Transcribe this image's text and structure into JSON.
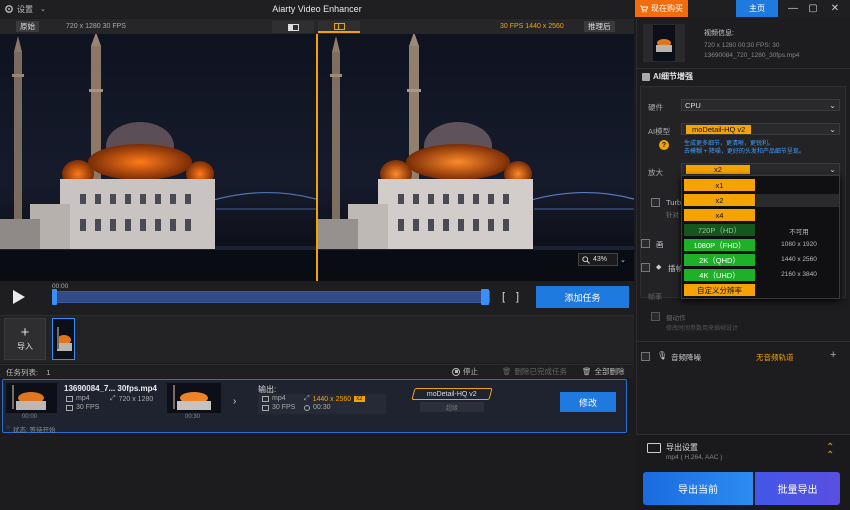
{
  "titlebar": {
    "settings_label": "设置",
    "app_title": "Aiarty Video Enhancer",
    "buy_now": "现在购买",
    "home": "主页"
  },
  "preview": {
    "original_label": "原始",
    "original_info": "720 x 1280  30 FPS",
    "output_info": "30 FPS  1440 x 2560",
    "after_label": "推理后",
    "zoom": "43%"
  },
  "scrub": {
    "time": "00:00",
    "add_task": "添加任务"
  },
  "import": {
    "label": "导入"
  },
  "tasklist": {
    "count_label": "任务列表:",
    "count": "1",
    "stop": "停止",
    "delete_done": "删除已完成任务",
    "delete_all": "全部删除"
  },
  "task": {
    "name": "13690084_7... 30fps.mp4",
    "in_format": "mp4",
    "in_res": "720 x 1280",
    "in_fps": "30 FPS",
    "in_duration": "00:30",
    "thumb_time_left": "00:00",
    "output_label": "输出:",
    "out_format": "mp4",
    "out_res": "1440 x 2560",
    "out_scale": "x2",
    "out_fps": "30 FPS",
    "out_duration": "00:30",
    "model": "moDetail-HQ  v2",
    "model_sub": "超级",
    "modify": "修改",
    "status": "状态: 等待开始"
  },
  "videoinfo": {
    "title": "视频信息:",
    "line1": "720 x 1280    00:30    FPS: 30",
    "line2": "13690084_720_1280_30fps.mp4"
  },
  "ai": {
    "section_title": "AI细节增强",
    "hardware_label": "硬件",
    "hardware_value": "CPU",
    "model_label": "AI模型",
    "model_value": "moDetail-HQ  v2",
    "model_desc_1": "生成更多细节，更清晰，更锐利。",
    "model_desc_2": "去模糊 + 降噪，更好的头发和产品细节呈现。",
    "scale_label": "放大",
    "scale_value": "x2",
    "turbo_label": "Turb",
    "turbo_sub": "针对",
    "dropdown_options": [
      {
        "label": "x1",
        "style": "orange"
      },
      {
        "label": "x2",
        "style": "orange"
      },
      {
        "label": "x4",
        "style": "orange"
      },
      {
        "label": "720P（HD）",
        "style": "darkgreen",
        "res": "不可用"
      },
      {
        "label": "1080P（FHD）",
        "style": "green",
        "res": "1080 x 1920"
      },
      {
        "label": "2K（QHD）",
        "style": "green",
        "res": "1440 x 2560"
      },
      {
        "label": "4K（UHD）",
        "style": "green",
        "res": "2160 x 3840"
      },
      {
        "label": "自定义分辨率",
        "style": "orange"
      }
    ],
    "section2": "画",
    "section3": "插帧",
    "frame_label": "帧率",
    "motion_label": "摄动作",
    "motion_desc": "修改时间参数用来插帧设计",
    "audio_label": "音频降噪",
    "audio_value": "无音频轨道"
  },
  "export": {
    "settings_title": "导出设置",
    "settings_sub": "mp4 ( H.264, AAC )",
    "export_current": "导出当前",
    "export_batch": "批量导出"
  },
  "colors": {
    "accent_blue": "#1f7ae0",
    "accent_orange": "#f5a300",
    "buy_orange": "#f26b0c",
    "option_green": "#1fb02a"
  }
}
